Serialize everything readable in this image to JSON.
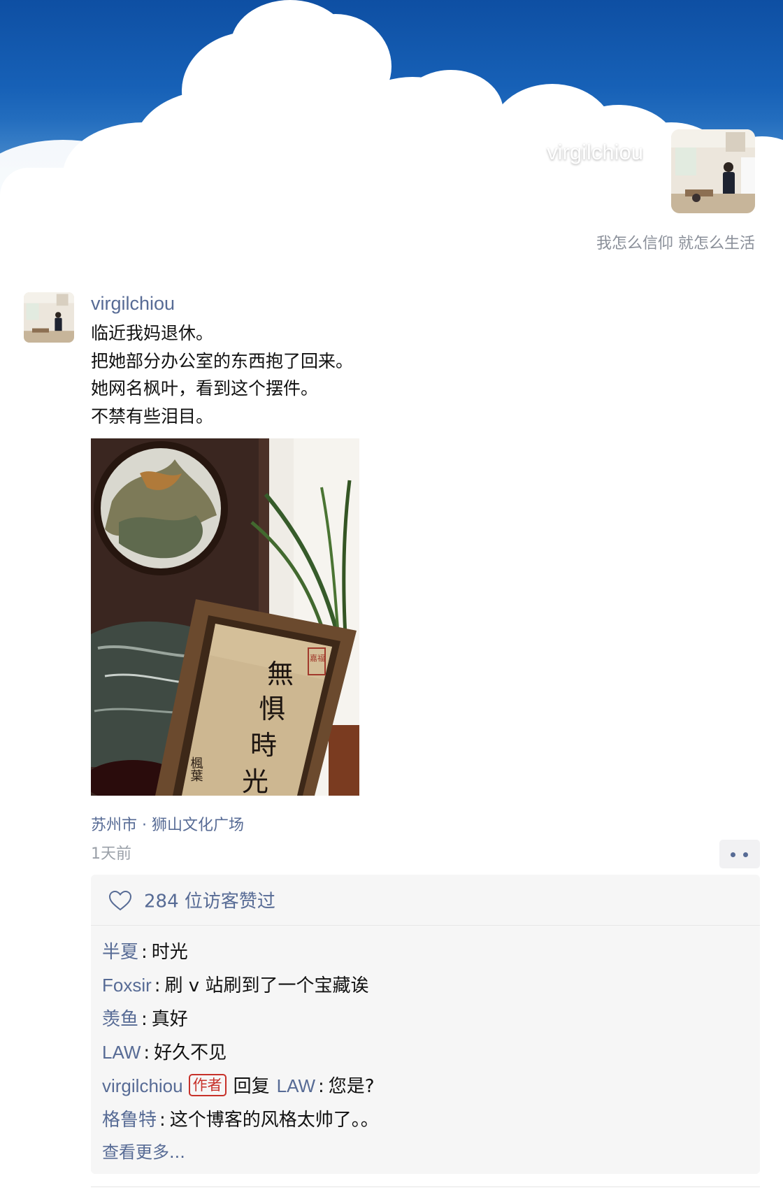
{
  "profile": {
    "name": "virgilchiou",
    "signature": "我怎么信仰 就怎么生活"
  },
  "post": {
    "author": "virgilchiou",
    "text_lines": [
      "临近我妈退休。",
      "把她部分办公室的东西抱了回来。",
      "她网名枫叶，看到这个摆件。",
      "不禁有些泪目。"
    ],
    "location": "苏州市 · 狮山文化广场",
    "time": "1天前",
    "likes": "284 位访客赞过",
    "comments": [
      {
        "name": "半夏",
        "text": "时光"
      },
      {
        "name": "Foxsir",
        "text": "刷 v 站刷到了一个宝藏诶"
      },
      {
        "name": "羡鱼",
        "text": "真好"
      },
      {
        "name": "LAW",
        "text": "好久不见"
      },
      {
        "name": "virgilchiou",
        "badge": "作者",
        "reply_word": "回复",
        "reply_to": "LAW",
        "text": "您是?"
      },
      {
        "name": "格鲁特",
        "text": "这个博客的风格太帅了。。"
      }
    ],
    "view_more": "查看更多..."
  },
  "photo": {
    "calligraphy": [
      "無",
      "惧",
      "時",
      "光"
    ],
    "signature": "楓葉",
    "seal": "嘉福"
  },
  "icons": {
    "like": "heart-outline-icon",
    "more": "more-dots-icon"
  },
  "colors": {
    "link": "#576b95",
    "author_badge": "#c7312a",
    "sky": "#1761b7"
  }
}
